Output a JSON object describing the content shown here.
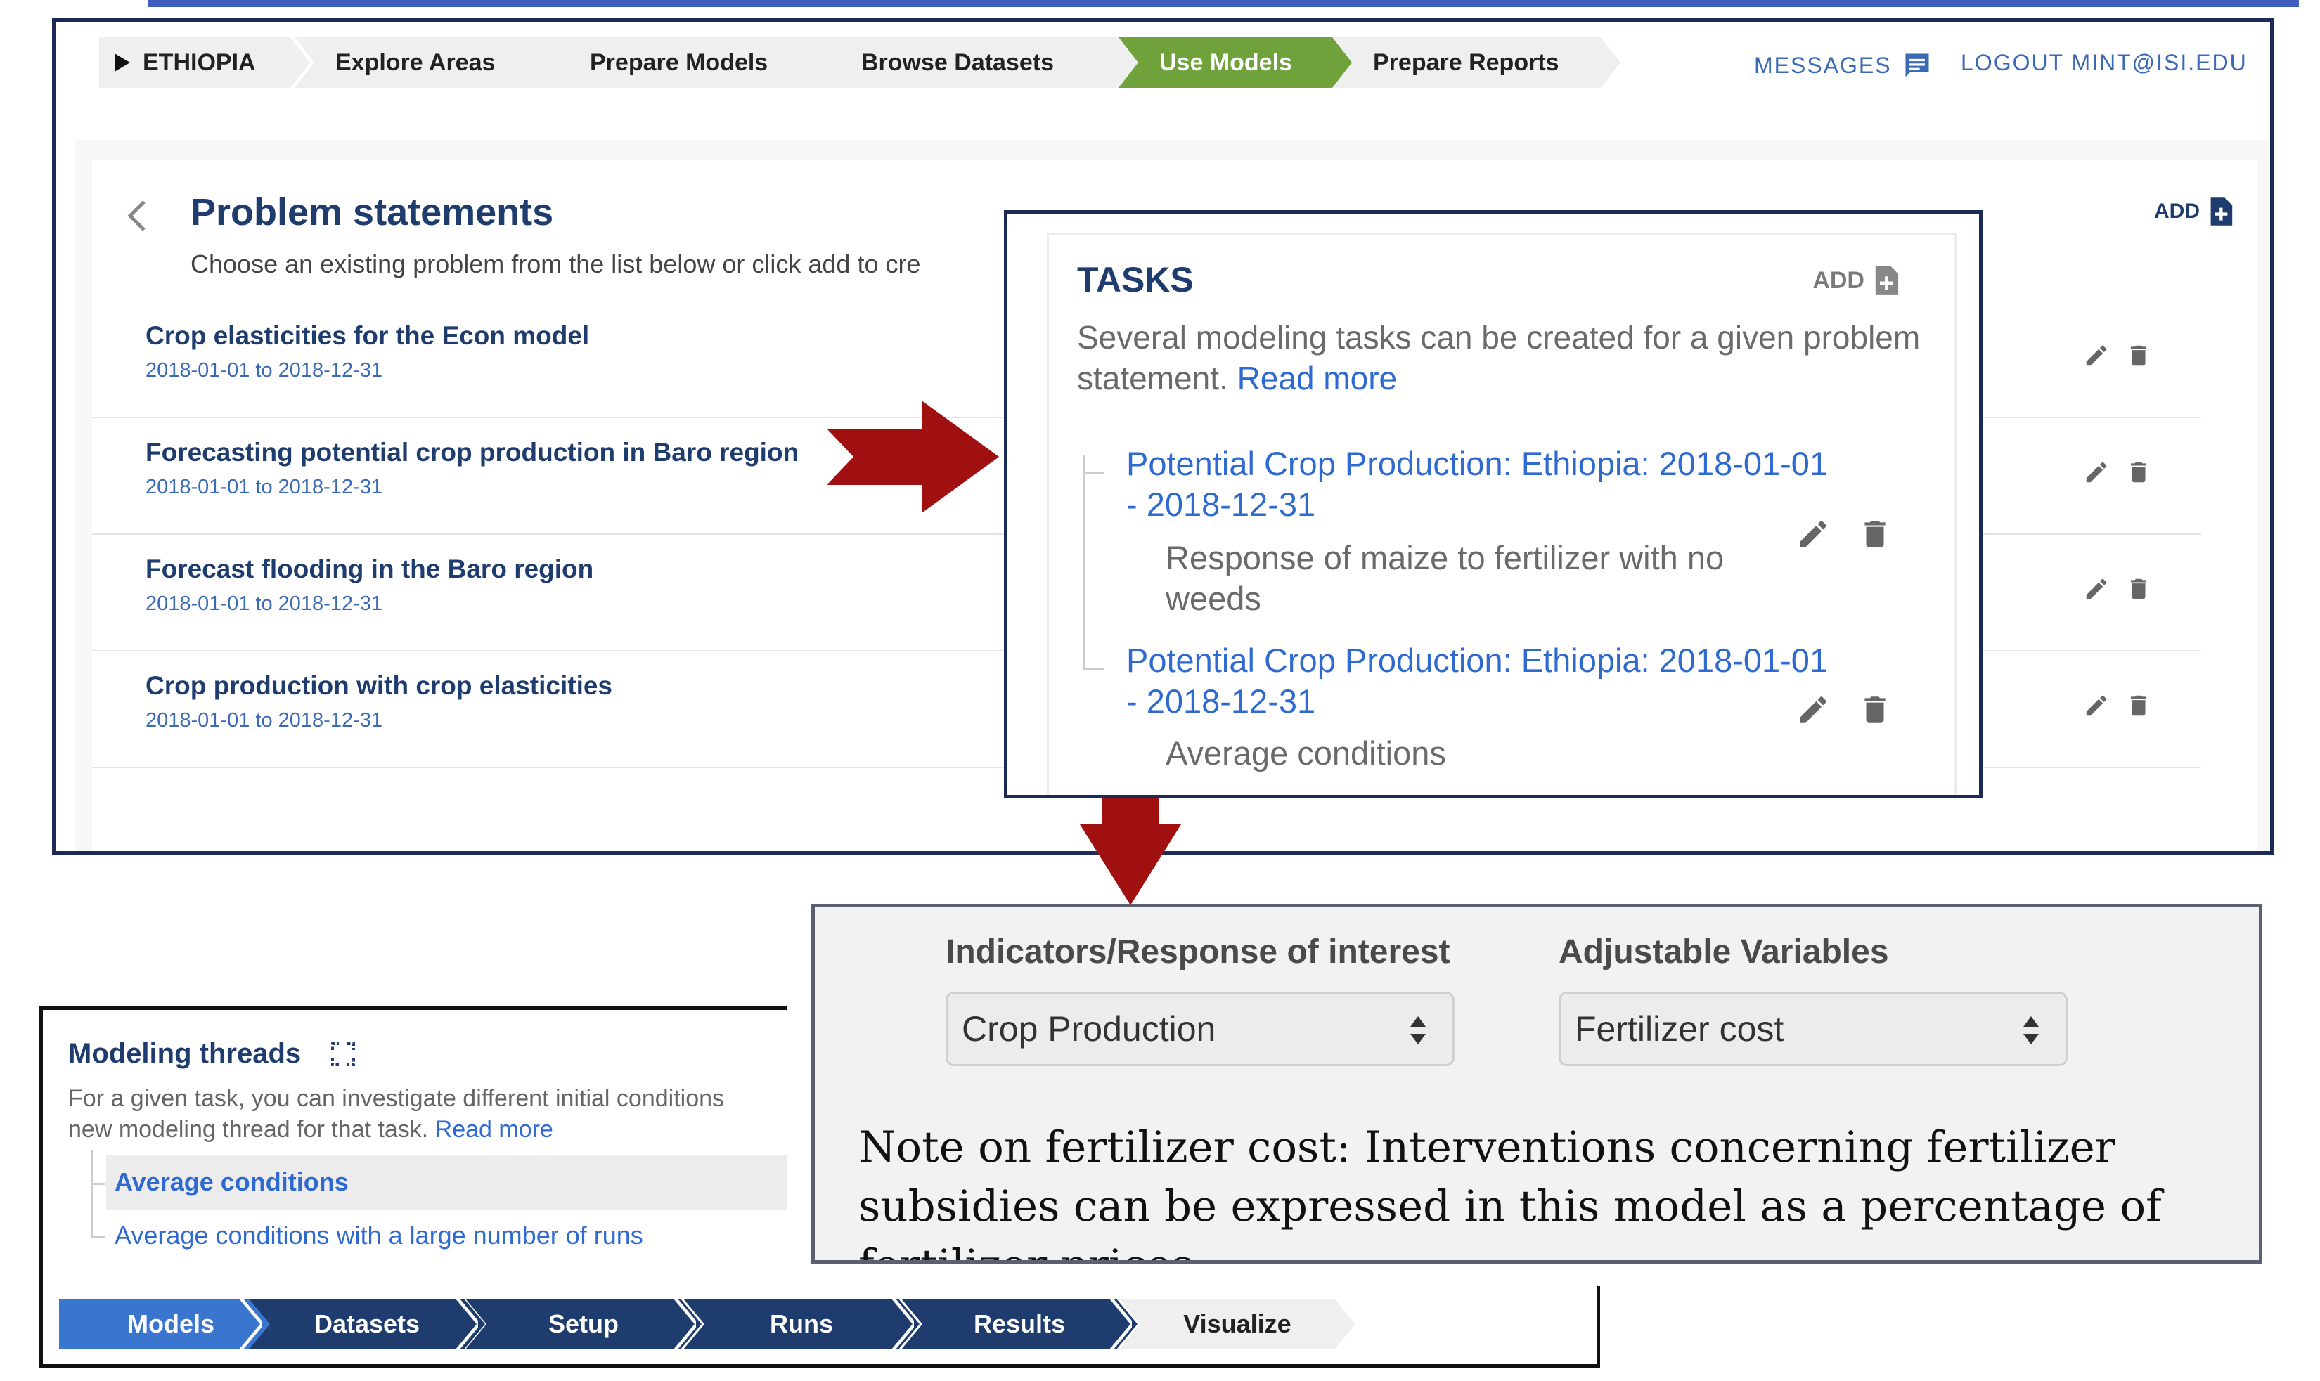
{
  "nav": {
    "region": "ETHIOPIA",
    "crumbs": [
      "Explore Areas",
      "Prepare Models",
      "Browse Datasets",
      "Use Models",
      "Prepare Reports"
    ],
    "active_crumb": "Use Models",
    "messages": "MESSAGES",
    "logout": "LOGOUT MINT@ISI.EDU"
  },
  "problems": {
    "title": "Problem statements",
    "subtitle": "Choose an existing problem from the list below or click add to cre",
    "add_label": "ADD",
    "rows": [
      {
        "title": "Crop elasticities for the Econ model",
        "dates": "2018-01-01 to 2018-12-31"
      },
      {
        "title": "Forecasting potential crop production in Baro region",
        "dates": "2018-01-01 to 2018-12-31"
      },
      {
        "title": "Forecast flooding in the Baro region",
        "dates": "2018-01-01 to 2018-12-31"
      },
      {
        "title": "Crop production with crop elasticities",
        "dates": "2018-01-01 to 2018-12-31"
      }
    ]
  },
  "tasks": {
    "title": "TASKS",
    "add_label": "ADD",
    "description": "Several modeling tasks can be created for a given problem statement.",
    "read_more": "Read more",
    "items": [
      {
        "title": "Potential Crop Production: Ethiopia: 2018-01-01 - 2018-12-31",
        "description": "Response of maize to fertilizer with no weeds"
      },
      {
        "title": "Potential Crop Production: Ethiopia: 2018-01-01 - 2018-12-31",
        "description": "Average conditions"
      }
    ]
  },
  "variables": {
    "indicators_label": "Indicators/Response of interest",
    "indicators_value": "Crop Production",
    "adjustable_label": "Adjustable Variables",
    "adjustable_value": "Fertilizer cost",
    "note": "Note on fertilizer cost: Interventions concerning fertilizer subsidies can be expressed in this model as a percentage of fertilizer prices"
  },
  "threads": {
    "title": "Modeling threads",
    "description_line1": "For a given task, you can investigate different initial conditions",
    "description_line2": "new modeling thread for that task.",
    "read_more": "Read more",
    "items": [
      "Average conditions",
      "Average conditions with a large number of runs"
    ]
  },
  "steps": [
    "Models",
    "Datasets",
    "Setup",
    "Runs",
    "Results",
    "Visualize"
  ],
  "colors": {
    "navy": "#1f3c6e",
    "link_blue": "#2f6ad0",
    "active_green": "#6fa23b",
    "arrow_red": "#a01010",
    "step_active": "#3a76d0"
  }
}
